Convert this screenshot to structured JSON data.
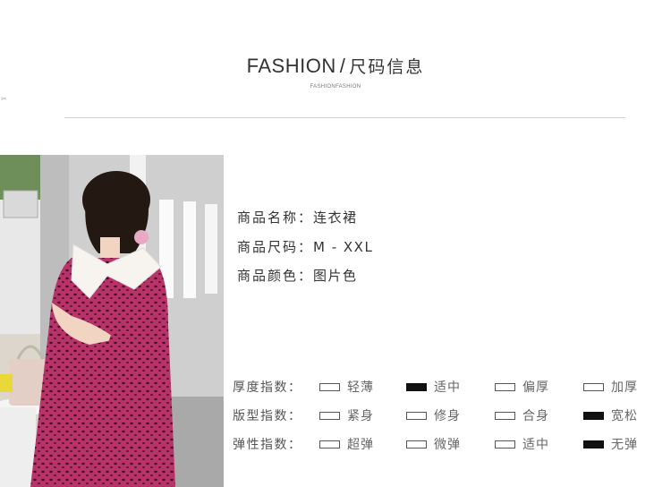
{
  "header": {
    "title_en": "FASHION",
    "title_sep": "/",
    "title_cn": "尺码信息",
    "subtitle": "FASHIONFASHION"
  },
  "product": {
    "name_label": "商品名称：",
    "name_value": "连衣裙",
    "size_label": "商品尺码：",
    "size_value": "M - XXL",
    "color_label": "商品颜色：",
    "color_value": "图片色"
  },
  "indices": [
    {
      "label": "厚度指数：",
      "options": [
        {
          "text": "轻薄",
          "selected": false
        },
        {
          "text": "适中",
          "selected": true
        },
        {
          "text": "偏厚",
          "selected": false
        },
        {
          "text": "加厚",
          "selected": false
        }
      ]
    },
    {
      "label": "版型指数：",
      "options": [
        {
          "text": "紧身",
          "selected": false
        },
        {
          "text": "修身",
          "selected": false
        },
        {
          "text": "合身",
          "selected": false
        },
        {
          "text": "宽松",
          "selected": true
        }
      ]
    },
    {
      "label": "弹性指数：",
      "options": [
        {
          "text": "超弹",
          "selected": false
        },
        {
          "text": "微弹",
          "selected": false
        },
        {
          "text": "适中",
          "selected": false
        },
        {
          "text": "无弹",
          "selected": true
        }
      ]
    }
  ],
  "colors": {
    "dress": "#b8336a",
    "indicator_on": "#111111"
  }
}
